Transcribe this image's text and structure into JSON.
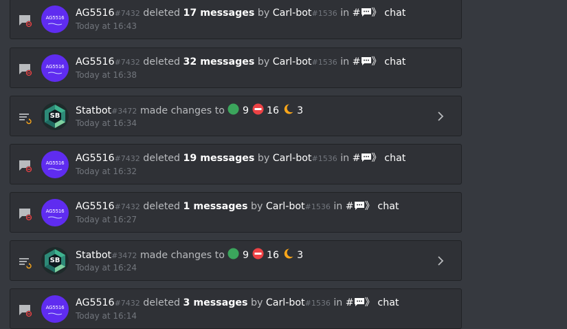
{
  "entries": [
    {
      "kind": "delete",
      "user": "AG5516",
      "disc": "#7432",
      "action": "deleted",
      "count": "17 messages",
      "by": "by",
      "target": "Carl-bot",
      "target_disc": "#1536",
      "in": "in",
      "hash": "#",
      "arrow": "》",
      "channel": "chat",
      "time": "Today at 16:43"
    },
    {
      "kind": "delete",
      "user": "AG5516",
      "disc": "#7432",
      "action": "deleted",
      "count": "32 messages",
      "by": "by",
      "target": "Carl-bot",
      "target_disc": "#1536",
      "in": "in",
      "hash": "#",
      "arrow": "》",
      "channel": "chat",
      "time": "Today at 16:38"
    },
    {
      "kind": "update",
      "user": "Statbot",
      "disc": "#3472",
      "action": "made changes to",
      "v1": "9",
      "v2": "16",
      "v3": "3",
      "time": "Today at 16:34"
    },
    {
      "kind": "delete",
      "user": "AG5516",
      "disc": "#7432",
      "action": "deleted",
      "count": "19 messages",
      "by": "by",
      "target": "Carl-bot",
      "target_disc": "#1536",
      "in": "in",
      "hash": "#",
      "arrow": "》",
      "channel": "chat",
      "time": "Today at 16:32"
    },
    {
      "kind": "delete",
      "user": "AG5516",
      "disc": "#7432",
      "action": "deleted",
      "count": "1 messages",
      "by": "by",
      "target": "Carl-bot",
      "target_disc": "#1536",
      "in": "in",
      "hash": "#",
      "arrow": "》",
      "channel": "chat",
      "time": "Today at 16:27"
    },
    {
      "kind": "update",
      "user": "Statbot",
      "disc": "#3472",
      "action": "made changes to",
      "v1": "9",
      "v2": "16",
      "v3": "3",
      "time": "Today at 16:24"
    },
    {
      "kind": "delete",
      "user": "AG5516",
      "disc": "#7432",
      "action": "deleted",
      "count": "3 messages",
      "by": "by",
      "target": "Carl-bot",
      "target_disc": "#1536",
      "in": "in",
      "hash": "#",
      "arrow": "》",
      "channel": "chat",
      "time": "Today at 16:14"
    }
  ],
  "avatars": {
    "ag_text": "AG5516",
    "sb_text": "SB"
  },
  "icons": {
    "delete": "message-delete-icon",
    "update": "channel-update-icon",
    "expand": "chevron-right-icon",
    "online": "green-circle-icon",
    "dnd": "no-entry-icon",
    "idle": "crescent-moon-icon",
    "channel": "speech-balloon-icon"
  },
  "colors": {
    "bg": "#36393f",
    "card": "#2f3136",
    "avatar_ag": "#5f2cf0",
    "online": "#3ba55c",
    "dnd": "#ed4245",
    "idle": "#faa61a"
  }
}
